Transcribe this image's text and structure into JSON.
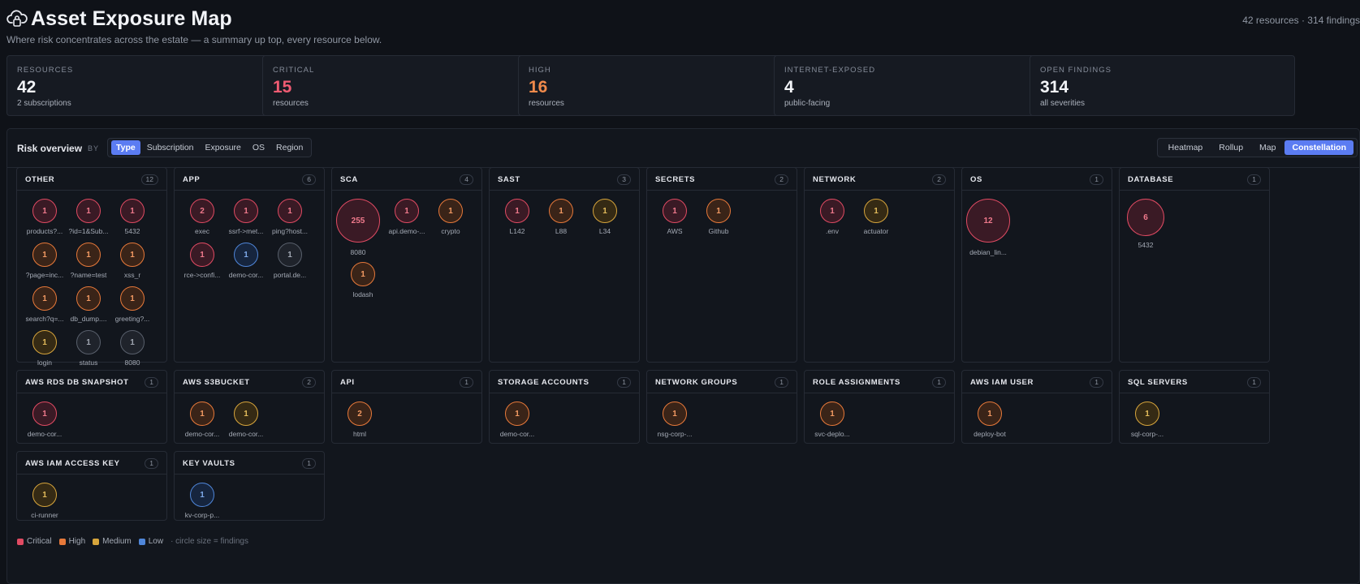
{
  "header": {
    "title": "Asset Exposure Map",
    "subtitle": "Where risk concentrates across the estate — a summary up top, every resource below.",
    "meta": "42 resources · 314 findings"
  },
  "stats": [
    {
      "label": "RESOURCES",
      "value": "42",
      "sub": "2 subscriptions",
      "color": "#f2f4f8"
    },
    {
      "label": "CRITICAL",
      "value": "15",
      "sub": "resources",
      "color": "#f05b72"
    },
    {
      "label": "HIGH",
      "value": "16",
      "sub": "resources",
      "color": "#f08a4b"
    },
    {
      "label": "INTERNET-EXPOSED",
      "value": "4",
      "sub": "public-facing",
      "color": "#f2f4f8"
    },
    {
      "label": "OPEN FINDINGS",
      "value": "314",
      "sub": "all severities",
      "color": "#f2f4f8"
    }
  ],
  "overview": {
    "title": "Risk overview",
    "by_label": "BY",
    "group_by": [
      "Type",
      "Subscription",
      "Exposure",
      "OS",
      "Region"
    ],
    "group_by_active": "Type",
    "views": [
      "Heatmap",
      "Rollup",
      "Map",
      "Constellation"
    ],
    "view_active": "Constellation"
  },
  "groups": [
    {
      "title": "OTHER",
      "count": "12",
      "nodes": [
        {
          "value": "1",
          "label": "products?...",
          "sev": "critical"
        },
        {
          "value": "1",
          "label": "?id=1&Sub...",
          "sev": "critical"
        },
        {
          "value": "1",
          "label": "5432",
          "sev": "critical"
        },
        {
          "value": "1",
          "label": "?page=inc...",
          "sev": "high"
        },
        {
          "value": "1",
          "label": "?name=test",
          "sev": "high"
        },
        {
          "value": "1",
          "label": "xss_r",
          "sev": "high"
        },
        {
          "value": "1",
          "label": "search?q=...",
          "sev": "high"
        },
        {
          "value": "1",
          "label": "db_dump....",
          "sev": "high"
        },
        {
          "value": "1",
          "label": "greeting?...",
          "sev": "high"
        },
        {
          "value": "1",
          "label": "login",
          "sev": "medium"
        },
        {
          "value": "1",
          "label": "status",
          "sev": "none"
        },
        {
          "value": "1",
          "label": "8080",
          "sev": "none"
        }
      ]
    },
    {
      "title": "APP",
      "count": "6",
      "nodes": [
        {
          "value": "2",
          "label": "exec",
          "sev": "critical"
        },
        {
          "value": "1",
          "label": "ssrf->met...",
          "sev": "critical"
        },
        {
          "value": "1",
          "label": "ping?host...",
          "sev": "critical"
        },
        {
          "value": "1",
          "label": "rce->confi...",
          "sev": "critical"
        },
        {
          "value": "1",
          "label": "demo-cor...",
          "sev": "low"
        },
        {
          "value": "1",
          "label": "portal.de...",
          "sev": "none"
        }
      ]
    },
    {
      "title": "SCA",
      "count": "4",
      "nodes": [
        {
          "value": "255",
          "label": "8080",
          "sev": "critical"
        },
        {
          "value": "1",
          "label": "api.demo-...",
          "sev": "critical"
        },
        {
          "value": "1",
          "label": "crypto",
          "sev": "high"
        },
        {
          "value": "1",
          "label": "lodash",
          "sev": "high"
        }
      ]
    },
    {
      "title": "SAST",
      "count": "3",
      "nodes": [
        {
          "value": "1",
          "label": "L142",
          "sev": "critical"
        },
        {
          "value": "1",
          "label": "L88",
          "sev": "high"
        },
        {
          "value": "1",
          "label": "L34",
          "sev": "medium"
        }
      ]
    },
    {
      "title": "SECRETS",
      "count": "2",
      "nodes": [
        {
          "value": "1",
          "label": "AWS",
          "sev": "critical"
        },
        {
          "value": "1",
          "label": "Github",
          "sev": "high"
        }
      ]
    },
    {
      "title": "NETWORK",
      "count": "2",
      "nodes": [
        {
          "value": "1",
          "label": ".env",
          "sev": "critical"
        },
        {
          "value": "1",
          "label": "actuator",
          "sev": "medium"
        }
      ]
    },
    {
      "title": "OS",
      "count": "1",
      "nodes": [
        {
          "value": "12",
          "label": "debian_lin...",
          "sev": "critical"
        }
      ]
    },
    {
      "title": "DATABASE",
      "count": "1",
      "nodes": [
        {
          "value": "6",
          "label": "5432",
          "sev": "critical"
        }
      ]
    },
    {
      "title": "AWS RDS DB SNAPSHOT",
      "count": "1",
      "nodes": [
        {
          "value": "1",
          "label": "demo-cor...",
          "sev": "critical"
        }
      ]
    },
    {
      "title": "AWS S3BUCKET",
      "count": "2",
      "nodes": [
        {
          "value": "1",
          "label": "demo-cor...",
          "sev": "high"
        },
        {
          "value": "1",
          "label": "demo-cor...",
          "sev": "medium"
        }
      ]
    },
    {
      "title": "API",
      "count": "1",
      "nodes": [
        {
          "value": "2",
          "label": "html",
          "sev": "high"
        }
      ]
    },
    {
      "title": "STORAGE ACCOUNTS",
      "count": "1",
      "nodes": [
        {
          "value": "1",
          "label": "demo-cor...",
          "sev": "high"
        }
      ]
    },
    {
      "title": "NETWORK GROUPS",
      "count": "1",
      "nodes": [
        {
          "value": "1",
          "label": "nsg-corp-...",
          "sev": "high"
        }
      ]
    },
    {
      "title": "ROLE ASSIGNMENTS",
      "count": "1",
      "nodes": [
        {
          "value": "1",
          "label": "svc-deplo...",
          "sev": "high"
        }
      ]
    },
    {
      "title": "AWS IAM USER",
      "count": "1",
      "nodes": [
        {
          "value": "1",
          "label": "deploy-bot",
          "sev": "high"
        }
      ]
    },
    {
      "title": "SQL SERVERS",
      "count": "1",
      "nodes": [
        {
          "value": "1",
          "label": "sql-corp-...",
          "sev": "medium"
        }
      ]
    },
    {
      "title": "AWS IAM ACCESS KEY",
      "count": "1",
      "nodes": [
        {
          "value": "1",
          "label": "ci-runner",
          "sev": "medium"
        }
      ]
    },
    {
      "title": "KEY VAULTS",
      "count": "1",
      "nodes": [
        {
          "value": "1",
          "label": "kv-corp-p...",
          "sev": "low"
        }
      ]
    }
  ],
  "legend": {
    "items": [
      {
        "label": "Critical",
        "color": "#e14b63"
      },
      {
        "label": "High",
        "color": "#e7793a"
      },
      {
        "label": "Medium",
        "color": "#d7a53c"
      },
      {
        "label": "Low",
        "color": "#4f86d9"
      }
    ],
    "note": "· circle size = findings"
  }
}
